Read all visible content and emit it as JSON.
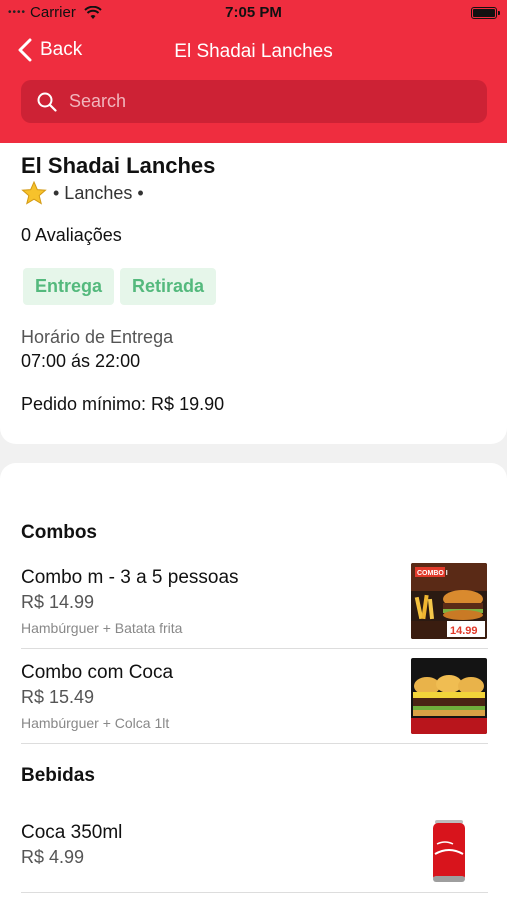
{
  "status_bar": {
    "carrier": "Carrier",
    "time": "7:05 PM"
  },
  "nav": {
    "back_label": "Back",
    "title": "El Shadai Lanches"
  },
  "search": {
    "placeholder": "Search"
  },
  "restaurant": {
    "name": "El Shadai Lanches",
    "category": "• Lanches •",
    "reviews": "0 Avaliações",
    "tags": [
      "Entrega",
      "Retirada"
    ],
    "hours_label": "Horário de Entrega",
    "hours_value": "07:00 ás 22:00",
    "minimum_order": "Pedido mínimo: R$ 19.90"
  },
  "menu": {
    "sections": [
      {
        "title": "Combos",
        "items": [
          {
            "name": "Combo m - 3 a 5 pessoas",
            "price": "R$ 14.99",
            "description": "Hambúrguer + Batata frita",
            "image_badge": "COMBO I",
            "image_price": "14.99"
          },
          {
            "name": "Combo com Coca",
            "price": "R$ 15.49",
            "description": "Hambúrguer + Colca 1lt"
          }
        ]
      },
      {
        "title": "Bebidas",
        "items": [
          {
            "name": "Coca 350ml",
            "price": "R$ 4.99"
          }
        ]
      }
    ]
  },
  "icons": {
    "wifi": "wifi-icon",
    "battery": "battery-icon",
    "back": "chevron-left-icon",
    "search": "search-icon",
    "star": "star-icon"
  },
  "colors": {
    "brand_red": "#ef2d3f",
    "search_bg": "#cd2235",
    "tag_bg": "#e6f6ea",
    "tag_text": "#54b97d"
  }
}
